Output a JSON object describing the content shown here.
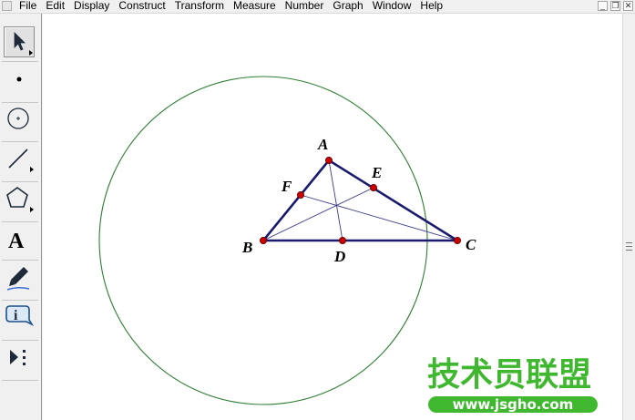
{
  "menubar": {
    "items": [
      "File",
      "Edit",
      "Display",
      "Construct",
      "Transform",
      "Measure",
      "Number",
      "Graph",
      "Window",
      "Help"
    ]
  },
  "window_controls": {
    "minimize": "_",
    "restore": "❐",
    "close": "✕"
  },
  "toolbox": {
    "tools": [
      {
        "name": "selection-arrow-tool",
        "active": true
      },
      {
        "name": "point-tool",
        "active": false
      },
      {
        "name": "compass-tool",
        "active": false
      },
      {
        "name": "straightedge-tool",
        "active": false
      },
      {
        "name": "polygon-tool",
        "active": false
      },
      {
        "name": "text-tool",
        "label": "A",
        "active": false
      },
      {
        "name": "marker-tool",
        "active": false
      },
      {
        "name": "information-tool",
        "label": "i",
        "active": false
      },
      {
        "name": "custom-tool",
        "active": false
      }
    ]
  },
  "sketch": {
    "point_labels": {
      "A": "A",
      "B": "B",
      "C": "C",
      "D": "D",
      "E": "E",
      "F": "F"
    },
    "colors": {
      "triangle": "#1a1a6e",
      "medians": "#3a3a8a",
      "circle": "#2e7d32",
      "points": "#cc0000"
    }
  },
  "watermark": {
    "title": "技术员联盟",
    "url": "www.jsgho.com",
    "color": "#3fb82f"
  }
}
